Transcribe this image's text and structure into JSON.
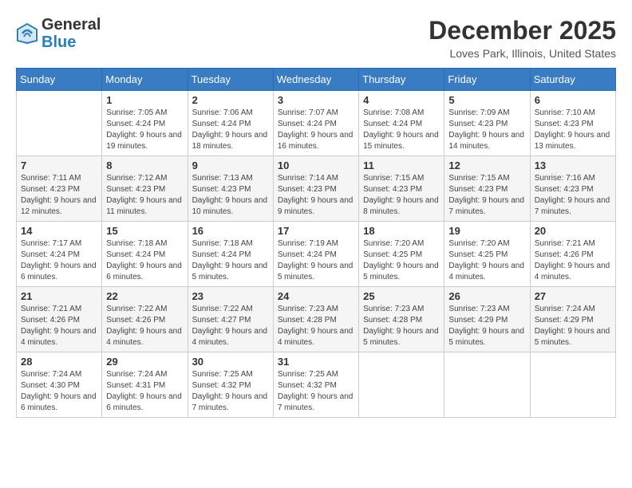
{
  "header": {
    "logo": {
      "general": "General",
      "blue": "Blue"
    },
    "title": "December 2025",
    "location": "Loves Park, Illinois, United States"
  },
  "calendar": {
    "days_of_week": [
      "Sunday",
      "Monday",
      "Tuesday",
      "Wednesday",
      "Thursday",
      "Friday",
      "Saturday"
    ],
    "weeks": [
      [
        {
          "day": "",
          "sunrise": "",
          "sunset": "",
          "daylight": ""
        },
        {
          "day": "1",
          "sunrise": "Sunrise: 7:05 AM",
          "sunset": "Sunset: 4:24 PM",
          "daylight": "Daylight: 9 hours and 19 minutes."
        },
        {
          "day": "2",
          "sunrise": "Sunrise: 7:06 AM",
          "sunset": "Sunset: 4:24 PM",
          "daylight": "Daylight: 9 hours and 18 minutes."
        },
        {
          "day": "3",
          "sunrise": "Sunrise: 7:07 AM",
          "sunset": "Sunset: 4:24 PM",
          "daylight": "Daylight: 9 hours and 16 minutes."
        },
        {
          "day": "4",
          "sunrise": "Sunrise: 7:08 AM",
          "sunset": "Sunset: 4:24 PM",
          "daylight": "Daylight: 9 hours and 15 minutes."
        },
        {
          "day": "5",
          "sunrise": "Sunrise: 7:09 AM",
          "sunset": "Sunset: 4:23 PM",
          "daylight": "Daylight: 9 hours and 14 minutes."
        },
        {
          "day": "6",
          "sunrise": "Sunrise: 7:10 AM",
          "sunset": "Sunset: 4:23 PM",
          "daylight": "Daylight: 9 hours and 13 minutes."
        }
      ],
      [
        {
          "day": "7",
          "sunrise": "Sunrise: 7:11 AM",
          "sunset": "Sunset: 4:23 PM",
          "daylight": "Daylight: 9 hours and 12 minutes."
        },
        {
          "day": "8",
          "sunrise": "Sunrise: 7:12 AM",
          "sunset": "Sunset: 4:23 PM",
          "daylight": "Daylight: 9 hours and 11 minutes."
        },
        {
          "day": "9",
          "sunrise": "Sunrise: 7:13 AM",
          "sunset": "Sunset: 4:23 PM",
          "daylight": "Daylight: 9 hours and 10 minutes."
        },
        {
          "day": "10",
          "sunrise": "Sunrise: 7:14 AM",
          "sunset": "Sunset: 4:23 PM",
          "daylight": "Daylight: 9 hours and 9 minutes."
        },
        {
          "day": "11",
          "sunrise": "Sunrise: 7:15 AM",
          "sunset": "Sunset: 4:23 PM",
          "daylight": "Daylight: 9 hours and 8 minutes."
        },
        {
          "day": "12",
          "sunrise": "Sunrise: 7:15 AM",
          "sunset": "Sunset: 4:23 PM",
          "daylight": "Daylight: 9 hours and 7 minutes."
        },
        {
          "day": "13",
          "sunrise": "Sunrise: 7:16 AM",
          "sunset": "Sunset: 4:23 PM",
          "daylight": "Daylight: 9 hours and 7 minutes."
        }
      ],
      [
        {
          "day": "14",
          "sunrise": "Sunrise: 7:17 AM",
          "sunset": "Sunset: 4:24 PM",
          "daylight": "Daylight: 9 hours and 6 minutes."
        },
        {
          "day": "15",
          "sunrise": "Sunrise: 7:18 AM",
          "sunset": "Sunset: 4:24 PM",
          "daylight": "Daylight: 9 hours and 6 minutes."
        },
        {
          "day": "16",
          "sunrise": "Sunrise: 7:18 AM",
          "sunset": "Sunset: 4:24 PM",
          "daylight": "Daylight: 9 hours and 5 minutes."
        },
        {
          "day": "17",
          "sunrise": "Sunrise: 7:19 AM",
          "sunset": "Sunset: 4:24 PM",
          "daylight": "Daylight: 9 hours and 5 minutes."
        },
        {
          "day": "18",
          "sunrise": "Sunrise: 7:20 AM",
          "sunset": "Sunset: 4:25 PM",
          "daylight": "Daylight: 9 hours and 5 minutes."
        },
        {
          "day": "19",
          "sunrise": "Sunrise: 7:20 AM",
          "sunset": "Sunset: 4:25 PM",
          "daylight": "Daylight: 9 hours and 4 minutes."
        },
        {
          "day": "20",
          "sunrise": "Sunrise: 7:21 AM",
          "sunset": "Sunset: 4:26 PM",
          "daylight": "Daylight: 9 hours and 4 minutes."
        }
      ],
      [
        {
          "day": "21",
          "sunrise": "Sunrise: 7:21 AM",
          "sunset": "Sunset: 4:26 PM",
          "daylight": "Daylight: 9 hours and 4 minutes."
        },
        {
          "day": "22",
          "sunrise": "Sunrise: 7:22 AM",
          "sunset": "Sunset: 4:26 PM",
          "daylight": "Daylight: 9 hours and 4 minutes."
        },
        {
          "day": "23",
          "sunrise": "Sunrise: 7:22 AM",
          "sunset": "Sunset: 4:27 PM",
          "daylight": "Daylight: 9 hours and 4 minutes."
        },
        {
          "day": "24",
          "sunrise": "Sunrise: 7:23 AM",
          "sunset": "Sunset: 4:28 PM",
          "daylight": "Daylight: 9 hours and 4 minutes."
        },
        {
          "day": "25",
          "sunrise": "Sunrise: 7:23 AM",
          "sunset": "Sunset: 4:28 PM",
          "daylight": "Daylight: 9 hours and 5 minutes."
        },
        {
          "day": "26",
          "sunrise": "Sunrise: 7:23 AM",
          "sunset": "Sunset: 4:29 PM",
          "daylight": "Daylight: 9 hours and 5 minutes."
        },
        {
          "day": "27",
          "sunrise": "Sunrise: 7:24 AM",
          "sunset": "Sunset: 4:29 PM",
          "daylight": "Daylight: 9 hours and 5 minutes."
        }
      ],
      [
        {
          "day": "28",
          "sunrise": "Sunrise: 7:24 AM",
          "sunset": "Sunset: 4:30 PM",
          "daylight": "Daylight: 9 hours and 6 minutes."
        },
        {
          "day": "29",
          "sunrise": "Sunrise: 7:24 AM",
          "sunset": "Sunset: 4:31 PM",
          "daylight": "Daylight: 9 hours and 6 minutes."
        },
        {
          "day": "30",
          "sunrise": "Sunrise: 7:25 AM",
          "sunset": "Sunset: 4:32 PM",
          "daylight": "Daylight: 9 hours and 7 minutes."
        },
        {
          "day": "31",
          "sunrise": "Sunrise: 7:25 AM",
          "sunset": "Sunset: 4:32 PM",
          "daylight": "Daylight: 9 hours and 7 minutes."
        },
        {
          "day": "",
          "sunrise": "",
          "sunset": "",
          "daylight": ""
        },
        {
          "day": "",
          "sunrise": "",
          "sunset": "",
          "daylight": ""
        },
        {
          "day": "",
          "sunrise": "",
          "sunset": "",
          "daylight": ""
        }
      ]
    ]
  }
}
